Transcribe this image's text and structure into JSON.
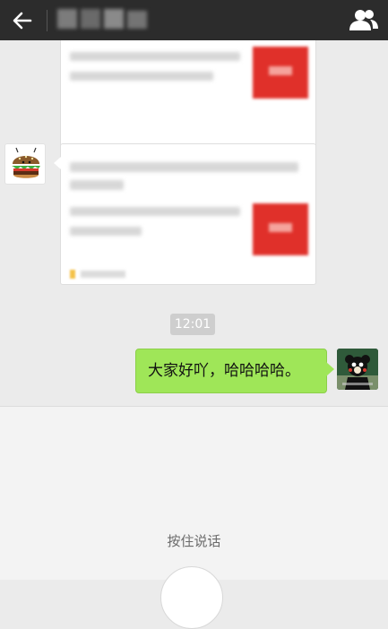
{
  "header": {
    "back_icon": "arrow-left-icon",
    "profile_icon": "group-users-icon",
    "background": "#2c2c2c"
  },
  "chat": {
    "background": "#ebebeb",
    "timestamp": "12:01",
    "outgoing_message": "大家好吖，哈哈哈哈。",
    "outgoing_bubble_color": "#9fe658",
    "shared_card_accent": "#e0302a"
  },
  "input": {
    "voice_hint": "按住说话"
  }
}
